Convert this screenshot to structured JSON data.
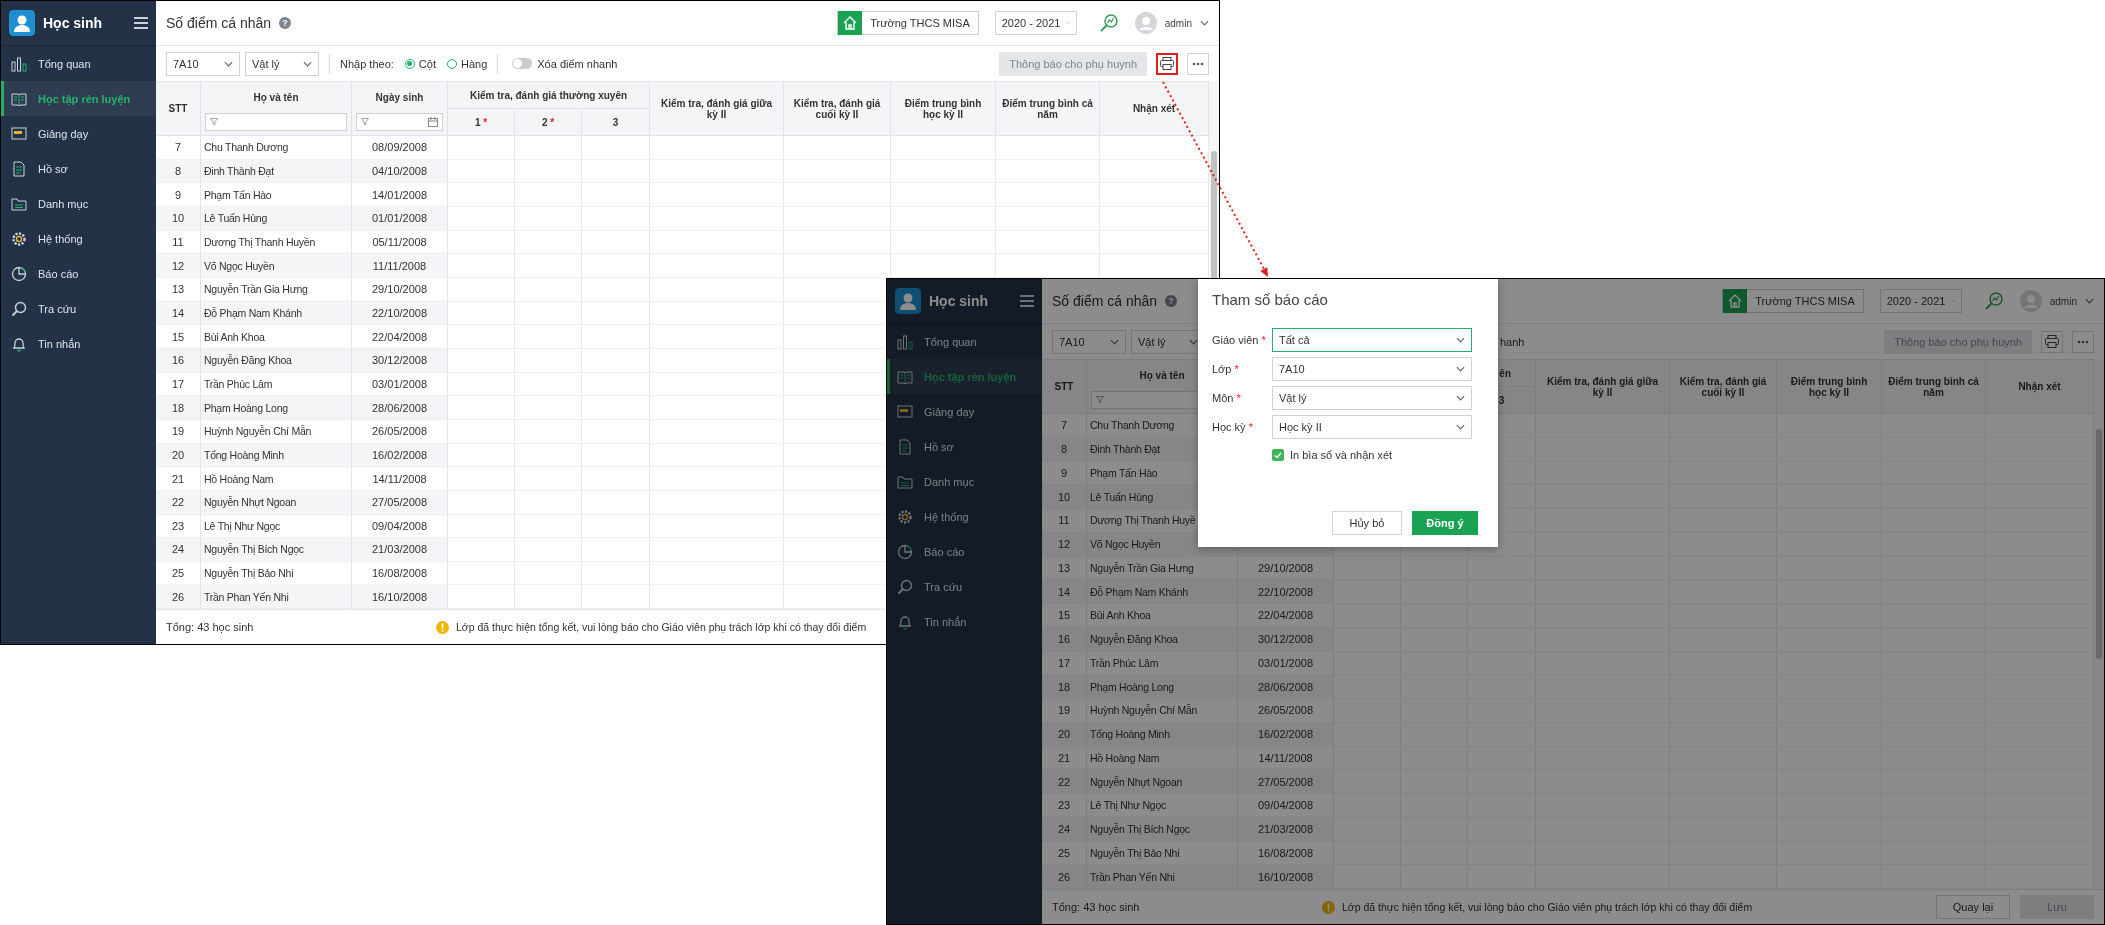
{
  "window_1": {
    "app_title": "Học sinh",
    "nav": [
      {
        "label": "Tổng quan",
        "selected": false
      },
      {
        "label": "Học tập rèn luyện",
        "selected": true
      },
      {
        "label": "Giảng dạy",
        "selected": false
      },
      {
        "label": "Hồ sơ",
        "selected": false
      },
      {
        "label": "Danh mục",
        "selected": false
      },
      {
        "label": "Hệ thống",
        "selected": false
      },
      {
        "label": "Báo cáo",
        "selected": false
      },
      {
        "label": "Tra cứu",
        "selected": false
      },
      {
        "label": "Tin nhắn",
        "selected": false
      }
    ],
    "page_title": "Số điểm cá nhân",
    "help_glyph": "?",
    "school": "Trường THCS MISA",
    "year": "2020 - 2021",
    "user": "admin",
    "toolbar": {
      "class_select": "7A10",
      "subject_select": "Vật lý",
      "input_mode": {
        "label": "Nhập theo:",
        "options": [
          {
            "label": "Cột",
            "selected": true
          },
          {
            "label": "Hàng",
            "selected": false
          }
        ]
      },
      "quick_delete": {
        "label": "Xóa điểm nhanh",
        "on": false
      },
      "notify_button": {
        "label": "Thông báo cho phụ huynh",
        "disabled": true
      },
      "print_button": {
        "highlighted": true
      }
    },
    "columns": [
      {
        "label": "STT"
      },
      {
        "label": "Họ và tên",
        "filter": true
      },
      {
        "label": "Ngày sinh",
        "filter": true,
        "date_picker": true
      },
      {
        "label": "Kiểm tra, đánh giá thường xuyên",
        "subcolumns": [
          {
            "label": "1",
            "mark": "*"
          },
          {
            "label": "2",
            "mark": "*"
          },
          {
            "label": "3"
          }
        ]
      },
      {
        "label": "Kiểm tra, đánh giá giữa kỳ II"
      },
      {
        "label": "Kiểm tra, đánh giá cuối kỳ II"
      },
      {
        "label": "Điểm trung bình học kỳ II"
      },
      {
        "label": "Điểm trung bình cả năm"
      },
      {
        "label": "Nhận xét"
      }
    ],
    "rows": [
      {
        "no": "7",
        "name": "Chu Thanh Dương",
        "birth_date": "08/09/2008"
      },
      {
        "no": "8",
        "name": "Đinh Thành Đạt",
        "birth_date": "04/10/2008"
      },
      {
        "no": "9",
        "name": "Phạm Tấn Hào",
        "birth_date": "14/01/2008"
      },
      {
        "no": "10",
        "name": "Lê Tuấn Hùng",
        "birth_date": "01/01/2008"
      },
      {
        "no": "11",
        "name": "Dương Thị Thanh Huyền",
        "birth_date": "05/11/2008"
      },
      {
        "no": "12",
        "name": "Võ Ngọc Huyền",
        "birth_date": "11/11/2008"
      },
      {
        "no": "13",
        "name": "Nguyễn Trần Gia Hưng",
        "birth_date": "29/10/2008"
      },
      {
        "no": "14",
        "name": "Đỗ Phạm Nam Khánh",
        "birth_date": "22/10/2008"
      },
      {
        "no": "15",
        "name": "Bùi Anh Khoa",
        "birth_date": "22/04/2008"
      },
      {
        "no": "16",
        "name": "Nguyễn Đăng Khoa",
        "birth_date": "30/12/2008"
      },
      {
        "no": "17",
        "name": "Trần Phúc Lâm",
        "birth_date": "03/01/2008"
      },
      {
        "no": "18",
        "name": "Phạm Hoàng Long",
        "birth_date": "28/06/2008"
      },
      {
        "no": "19",
        "name": "Huỳnh Nguyễn Chí Mẫn",
        "birth_date": "26/05/2008"
      },
      {
        "no": "20",
        "name": "Tống Hoàng Minh",
        "birth_date": "16/02/2008"
      },
      {
        "no": "21",
        "name": "Hồ Hoàng Nam",
        "birth_date": "14/11/2008"
      },
      {
        "no": "22",
        "name": "Nguyễn Nhựt Ngoan",
        "birth_date": "27/05/2008"
      },
      {
        "no": "23",
        "name": "Lê Thị Như Ngọc",
        "birth_date": "09/04/2008"
      },
      {
        "no": "24",
        "name": "Nguyễn Thị Bích Ngọc",
        "birth_date": "21/03/2008"
      },
      {
        "no": "25",
        "name": "Nguyễn Thị Bảo Nhi",
        "birth_date": "16/08/2008"
      },
      {
        "no": "26",
        "name": "Trần Phan Yến Nhi",
        "birth_date": "16/10/2008"
      }
    ],
    "total": "Tổng: 43 học sinh",
    "notice": "Lớp đã thực hiện tổng kết, vui lòng báo cho Giáo viên phụ trách lớp khi có thay đổi điểm"
  },
  "window_2": {
    "app_title": "Học sinh",
    "nav": [
      {
        "label": "Tổng quan",
        "selected": false
      },
      {
        "label": "Học tập rèn luyện",
        "selected": true
      },
      {
        "label": "Giảng dạy",
        "selected": false
      },
      {
        "label": "Hồ sơ",
        "selected": false
      },
      {
        "label": "Danh mục",
        "selected": false
      },
      {
        "label": "Hệ thống",
        "selected": false
      },
      {
        "label": "Báo cáo",
        "selected": false
      },
      {
        "label": "Tra cứu",
        "selected": false
      },
      {
        "label": "Tin nhắn",
        "selected": false
      }
    ],
    "page_title": "Số điểm cá nhân",
    "help_glyph": "?",
    "school": "Trường THCS MISA",
    "year": "2020 - 2021",
    "user": "admin",
    "toolbar": {
      "class_select": "7A10",
      "subject_select": "Vật lý",
      "fragment": "hanh",
      "notify_button": {
        "label": "Thông báo cho phụ huynh",
        "disabled": true
      },
      "print_button": {
        "highlighted": false
      }
    },
    "columns": [
      {
        "label": "STT"
      },
      {
        "label": "Họ và tên",
        "filter": true
      },
      {},
      {
        "label": "ên",
        "clipped": true,
        "subcolumns": [
          {},
          {},
          {
            "label": "3"
          }
        ]
      },
      {
        "label": "Kiểm tra, đánh giá giữa kỳ II"
      },
      {
        "label": "Kiểm tra, đánh giá cuối kỳ II"
      },
      {
        "label": "Điểm trung bình học kỳ II"
      },
      {
        "label": "Điểm trung bình cả năm"
      },
      {
        "label": "Nhận xét"
      }
    ],
    "rows": [
      {
        "no": "7",
        "name": "Chu Thanh Dương"
      },
      {
        "no": "8",
        "name": "Đinh Thành Đạt"
      },
      {
        "no": "9",
        "name": "Phạm Tấn Hào"
      },
      {
        "no": "10",
        "name": "Lê Tuấn Hùng"
      },
      {
        "no": "11",
        "name": "Dương Thị Thanh Huyề"
      },
      {
        "no": "12",
        "name": "Võ Ngọc Huyền"
      },
      {
        "no": "13",
        "name": "Nguyễn Trần Gia Hưng",
        "birth_date": "29/10/2008"
      },
      {
        "no": "14",
        "name": "Đỗ Phạm Nam Khánh",
        "birth_date": "22/10/2008"
      },
      {
        "no": "15",
        "name": "Bùi Anh Khoa",
        "birth_date": "22/04/2008"
      },
      {
        "no": "16",
        "name": "Nguyễn Đăng Khoa",
        "birth_date": "30/12/2008"
      },
      {
        "no": "17",
        "name": "Trần Phúc Lâm",
        "birth_date": "03/01/2008"
      },
      {
        "no": "18",
        "name": "Phạm Hoàng Long",
        "birth_date": "28/06/2008"
      },
      {
        "no": "19",
        "name": "Huỳnh Nguyễn Chí Mẫn",
        "birth_date": "26/05/2008"
      },
      {
        "no": "20",
        "name": "Tống Hoàng Minh",
        "birth_date": "16/02/2008"
      },
      {
        "no": "21",
        "name": "Hồ Hoàng Nam",
        "birth_date": "14/11/2008"
      },
      {
        "no": "22",
        "name": "Nguyễn Nhựt Ngoan",
        "birth_date": "27/05/2008"
      },
      {
        "no": "23",
        "name": "Lê Thị Như Ngọc",
        "birth_date": "09/04/2008"
      },
      {
        "no": "24",
        "name": "Nguyễn Thị Bích Ngọc",
        "birth_date": "21/03/2008"
      },
      {
        "no": "25",
        "name": "Nguyễn Thị Bảo Nhi",
        "birth_date": "16/08/2008"
      },
      {
        "no": "26",
        "name": "Trần Phan Yến Nhi",
        "birth_date": "16/10/2008"
      }
    ],
    "total": "Tổng: 43 học sinh",
    "notice": "Lớp đã thực hiện tổng kết, vui lòng báo cho Giáo viên phụ trách lớp khi có thay đổi điểm",
    "footer_buttons": [
      {
        "label": "Quay lại",
        "disabled": false
      },
      {
        "label": "Lưu",
        "disabled": true
      }
    ],
    "dialog": {
      "title": "Tham số báo cáo",
      "fields": [
        {
          "label": "Giáo viên",
          "mark": "*",
          "value": "Tất cả",
          "focused": true
        },
        {
          "label": "Lớp",
          "mark": "*",
          "value": "7A10",
          "focused": false
        },
        {
          "label": "Môn",
          "mark": "*",
          "value": "Vật lý",
          "focused": false
        },
        {
          "label": "Học kỳ",
          "mark": "*",
          "value": "Học kỳ II",
          "focused": false
        }
      ],
      "checkbox": {
        "label": "In bìa sổ và nhận xét",
        "checked": true
      },
      "buttons": [
        {
          "label": "Hủy bỏ",
          "kind": "secondary"
        },
        {
          "label": "Đồng ý",
          "kind": "primary"
        }
      ]
    }
  }
}
